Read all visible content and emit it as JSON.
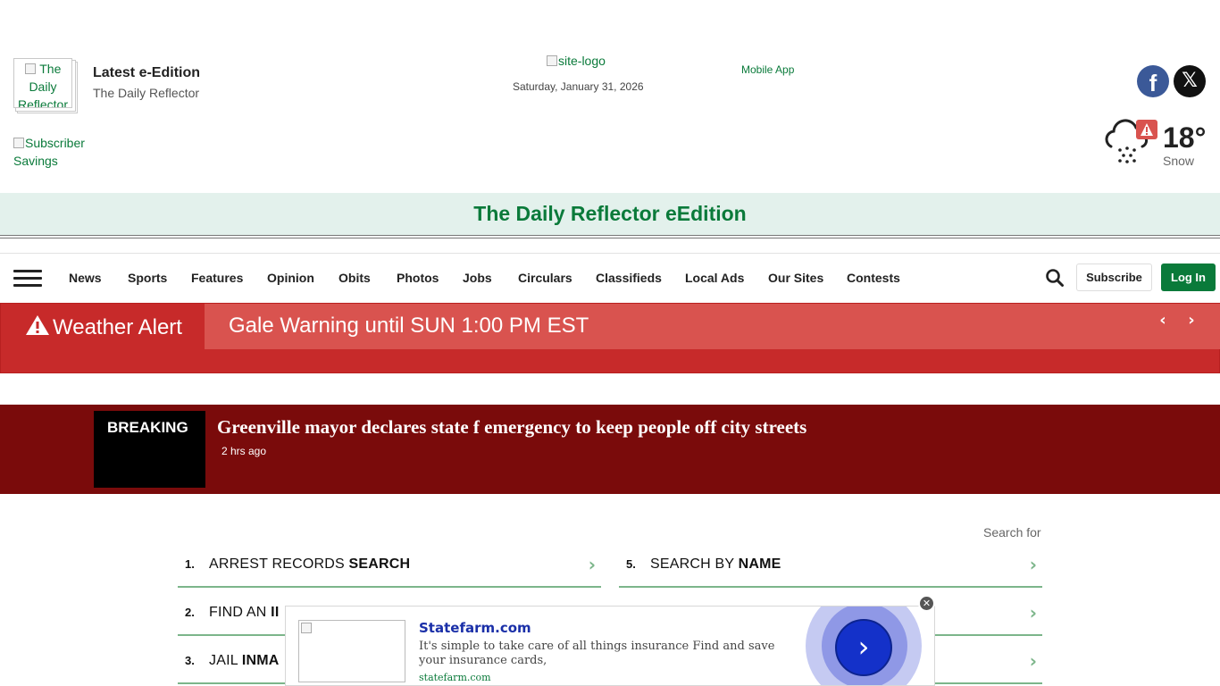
{
  "header": {
    "eedition_thumb_alt": "The Daily Reflector",
    "eedition_title": "Latest e-Edition",
    "eedition_subtitle": "The Daily Reflector",
    "subscriber_savings_alt": "Subscriber Savings",
    "logo_alt": "site-logo",
    "date": "Saturday, January 31, 2026",
    "mobile_app": "Mobile App",
    "social": {
      "facebook_icon": "facebook-icon",
      "x_icon": "x-twitter-icon"
    },
    "weather": {
      "temp": "18°",
      "condition": "Snow",
      "icon": "snow-cloud-alert-icon"
    }
  },
  "edition_banner": "The Daily Reflector eEdition",
  "nav": {
    "items": [
      "News",
      "Sports",
      "Features",
      "Opinion",
      "Obits",
      "Photos",
      "Jobs",
      "Circulars",
      "Classifieds",
      "Local Ads",
      "Our Sites",
      "Contests"
    ],
    "subscribe": "Subscribe",
    "login": "Log In"
  },
  "weather_alert": {
    "label": "Weather Alert",
    "message": "Gale Warning until SUN 1:00 PM EST",
    "color": "#c72a2a"
  },
  "breaking": {
    "tag": "BREAKING",
    "headline": "Greenville mayor declares state f emergency to keep people off city streets",
    "time": "2 hrs ago"
  },
  "search_list": {
    "header": "Search for",
    "items": [
      {
        "num": "1.",
        "label_plain": "ARREST RECORDS ",
        "label_bold": "SEARCH"
      },
      {
        "num": "2.",
        "label_plain": "FIND AN ",
        "label_bold": "II"
      },
      {
        "num": "3.",
        "label_plain": "JAIL ",
        "label_bold": "INMA"
      },
      {
        "num": "5.",
        "label_plain": "SEARCH BY ",
        "label_bold": "NAME"
      },
      {
        "num": "",
        "label_plain": "",
        "label_bold": ""
      },
      {
        "num": "",
        "label_plain": "",
        "label_bold": ""
      }
    ]
  },
  "ad": {
    "title": "Statefarm.com",
    "text": "It's simple to take care of all things insurance Find and save your insurance cards,",
    "url": "statefarm.com",
    "cta_icon": "chevron-right-icon",
    "close_icon": "close-icon"
  }
}
